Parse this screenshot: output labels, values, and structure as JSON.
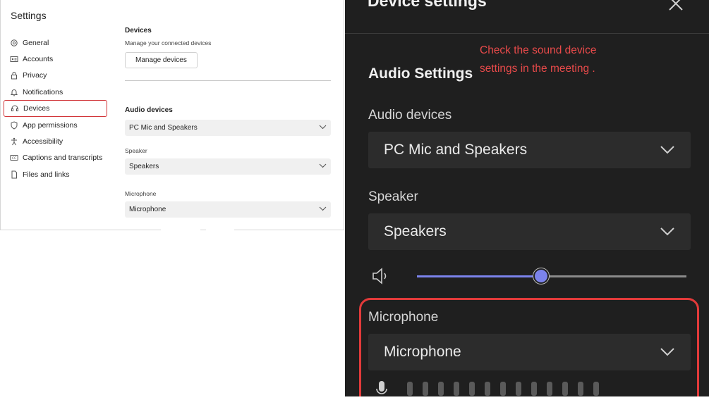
{
  "settings": {
    "title": "Settings",
    "nav": [
      {
        "label": "General",
        "icon": "gear-icon"
      },
      {
        "label": "Accounts",
        "icon": "id-card-icon"
      },
      {
        "label": "Privacy",
        "icon": "lock-icon"
      },
      {
        "label": "Notifications",
        "icon": "bell-icon"
      },
      {
        "label": "Devices",
        "icon": "headset-icon",
        "active": true
      },
      {
        "label": "App permissions",
        "icon": "shield-icon"
      },
      {
        "label": "Accessibility",
        "icon": "accessibility-icon"
      },
      {
        "label": "Captions and transcripts",
        "icon": "cc-icon"
      },
      {
        "label": "Files and links",
        "icon": "file-icon"
      }
    ],
    "devices": {
      "heading": "Devices",
      "description": "Manage your connected devices",
      "manage_button": "Manage devices"
    },
    "audio": {
      "heading": "Audio devices",
      "audio_device_value": "PC Mic and Speakers",
      "speaker_label": "Speaker",
      "speaker_value": "Speakers",
      "microphone_label": "Microphone",
      "microphone_value": "Microphone"
    }
  },
  "panel": {
    "title": "Device settings",
    "annotation_line1": "Check the sound device",
    "annotation_line2": "settings in the meeting .",
    "audio_settings_heading": "Audio Settings",
    "audio_devices_label": "Audio devices",
    "audio_devices_value": "PC Mic and Speakers",
    "speaker_label": "Speaker",
    "speaker_value": "Speakers",
    "volume_fraction": 0.46,
    "microphone_label": "Microphone",
    "microphone_value": "Microphone",
    "annotation_color": "#e84a4a",
    "accent_color": "#7b83eb"
  }
}
